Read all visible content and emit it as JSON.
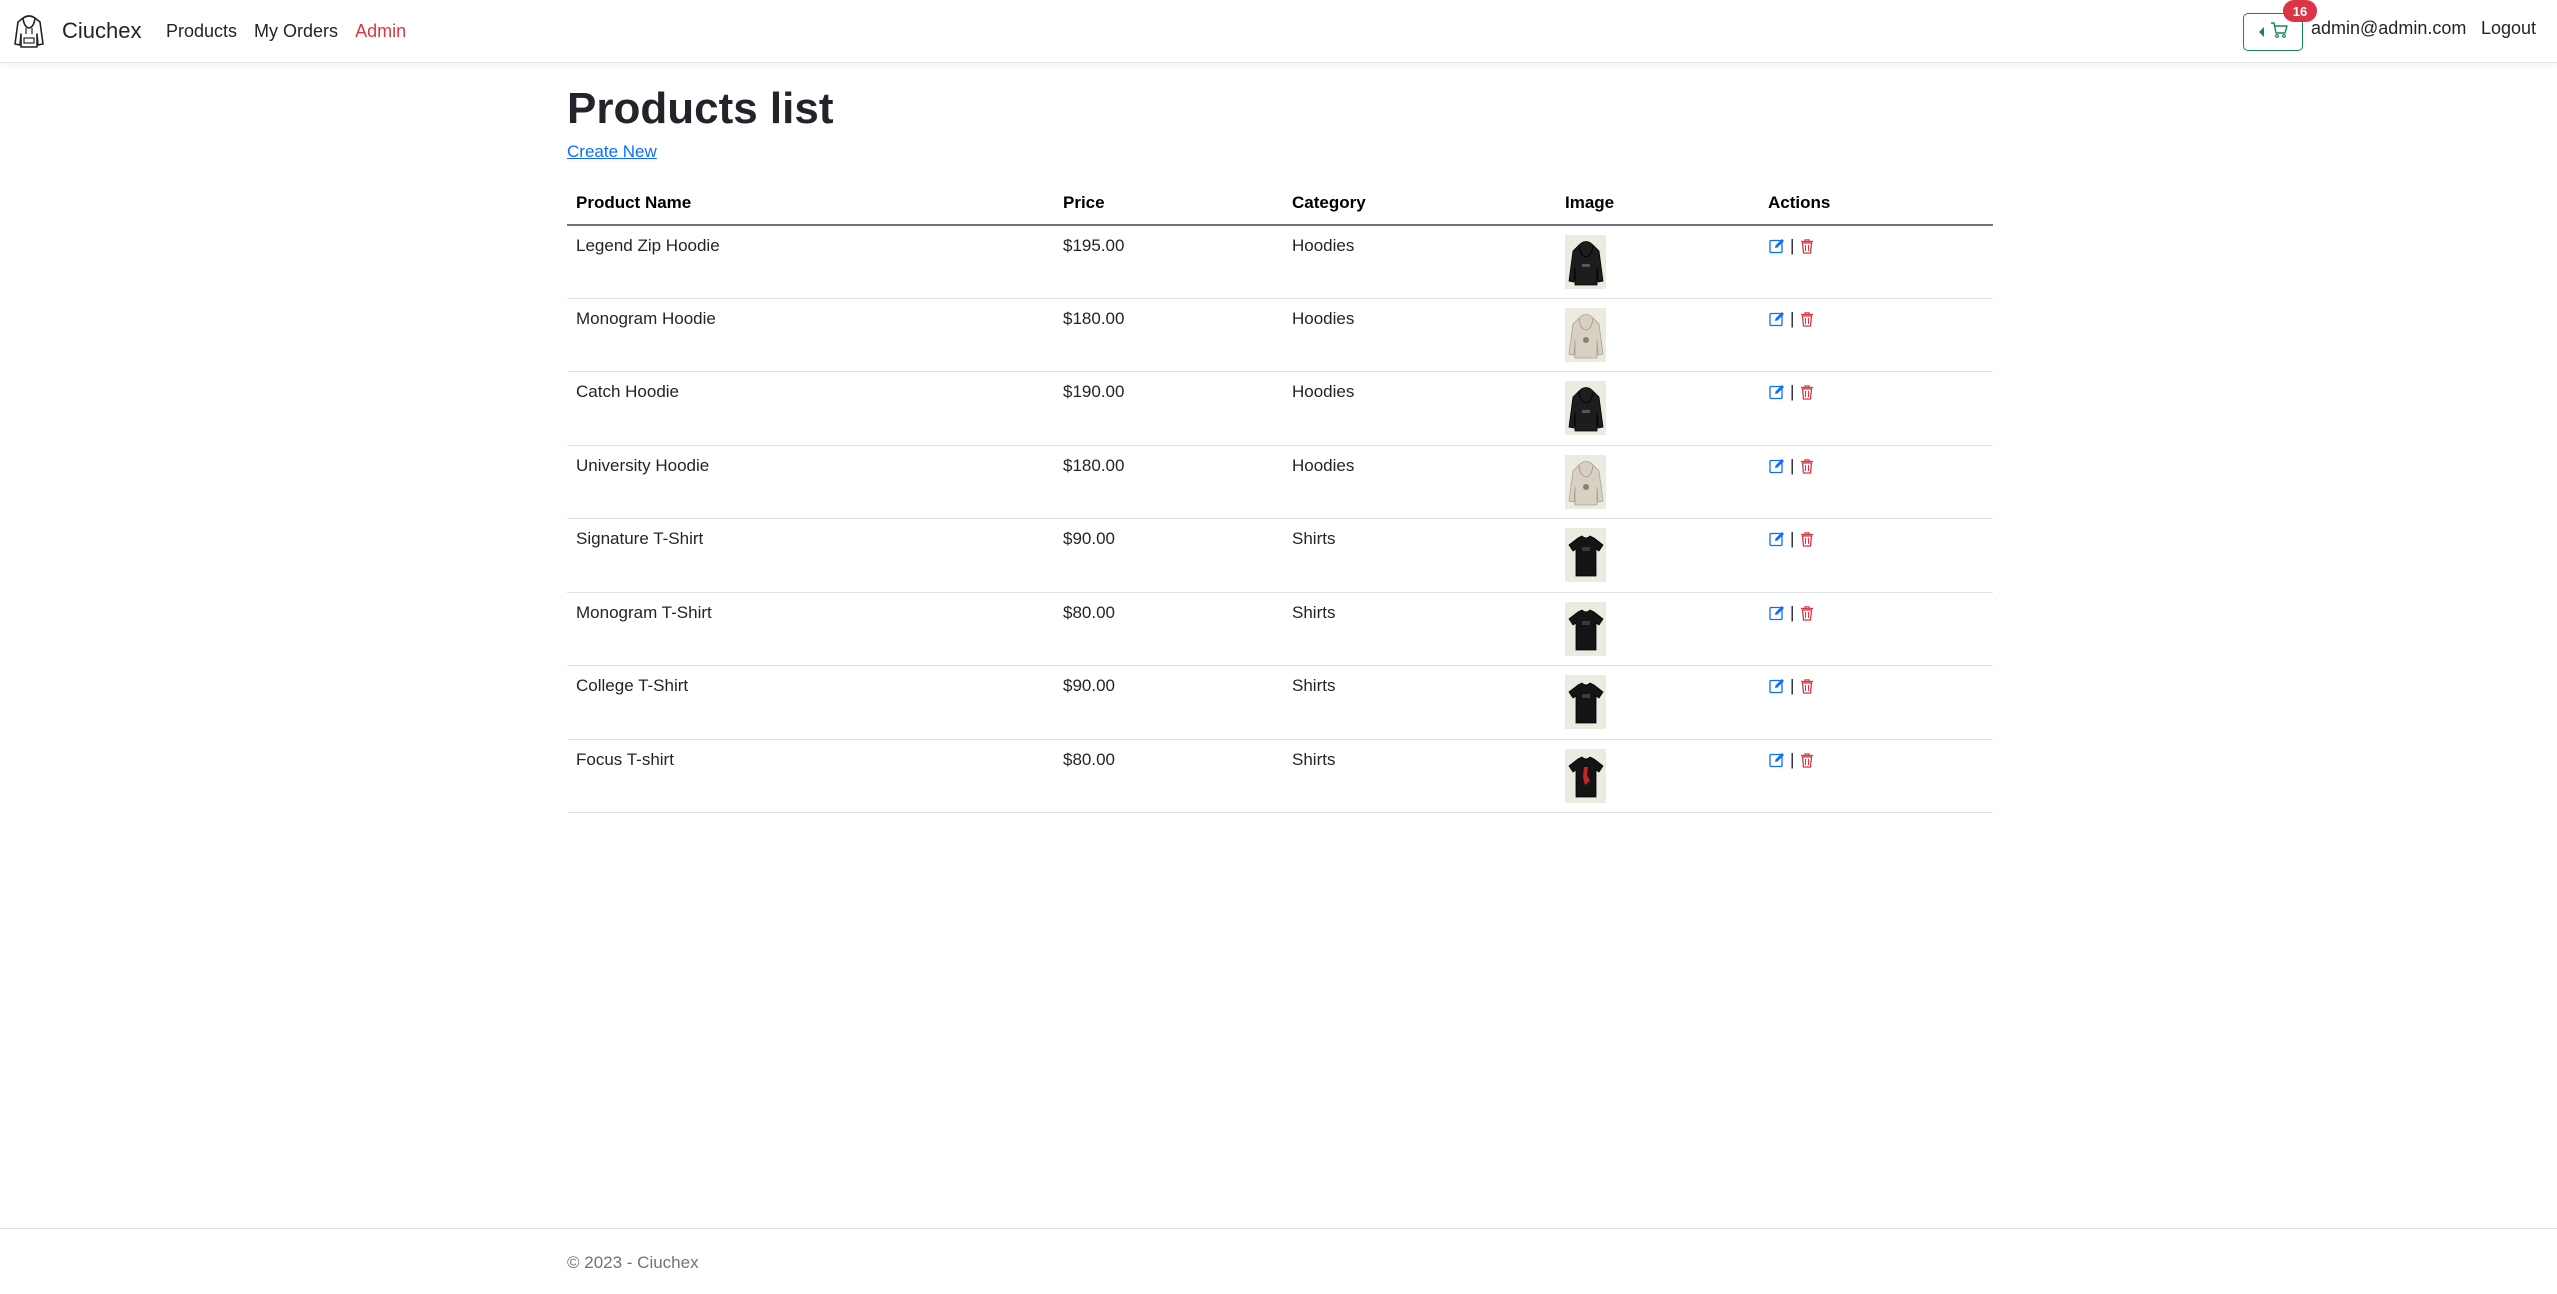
{
  "navbar": {
    "brand": "Ciuchex",
    "links": {
      "products": "Products",
      "orders": "My Orders",
      "admin": "Admin"
    },
    "cart_count": "16",
    "user_email": "admin@admin.com",
    "logout": "Logout"
  },
  "main": {
    "title": "Products list",
    "create_new": "Create New",
    "table": {
      "headers": {
        "name": "Product Name",
        "price": "Price",
        "category": "Category",
        "image": "Image",
        "actions": "Actions"
      },
      "rows": [
        {
          "name": "Legend Zip Hoodie",
          "price": "$195.00",
          "category": "Hoodies",
          "image_type": "hoodie-black"
        },
        {
          "name": "Monogram Hoodie",
          "price": "$180.00",
          "category": "Hoodies",
          "image_type": "hoodie-cream"
        },
        {
          "name": "Catch Hoodie",
          "price": "$190.00",
          "category": "Hoodies",
          "image_type": "hoodie-black"
        },
        {
          "name": "University Hoodie",
          "price": "$180.00",
          "category": "Hoodies",
          "image_type": "hoodie-cream"
        },
        {
          "name": "Signature T-Shirt",
          "price": "$90.00",
          "category": "Shirts",
          "image_type": "tshirt-black"
        },
        {
          "name": "Monogram T-Shirt",
          "price": "$80.00",
          "category": "Shirts",
          "image_type": "tshirt-black"
        },
        {
          "name": "College T-Shirt",
          "price": "$90.00",
          "category": "Shirts",
          "image_type": "tshirt-black"
        },
        {
          "name": "Focus T-shirt",
          "price": "$80.00",
          "category": "Shirts",
          "image_type": "tshirt-black-red"
        }
      ],
      "action_separator": "|"
    }
  },
  "footer": {
    "text": "© 2023 - Ciuchex"
  },
  "colors": {
    "admin_link": "#dc3545",
    "cart_border": "#198754",
    "badge": "#dc3545",
    "link": "#0d6efd",
    "edit_icon": "#0d6efd",
    "delete_icon": "#dc3545"
  }
}
